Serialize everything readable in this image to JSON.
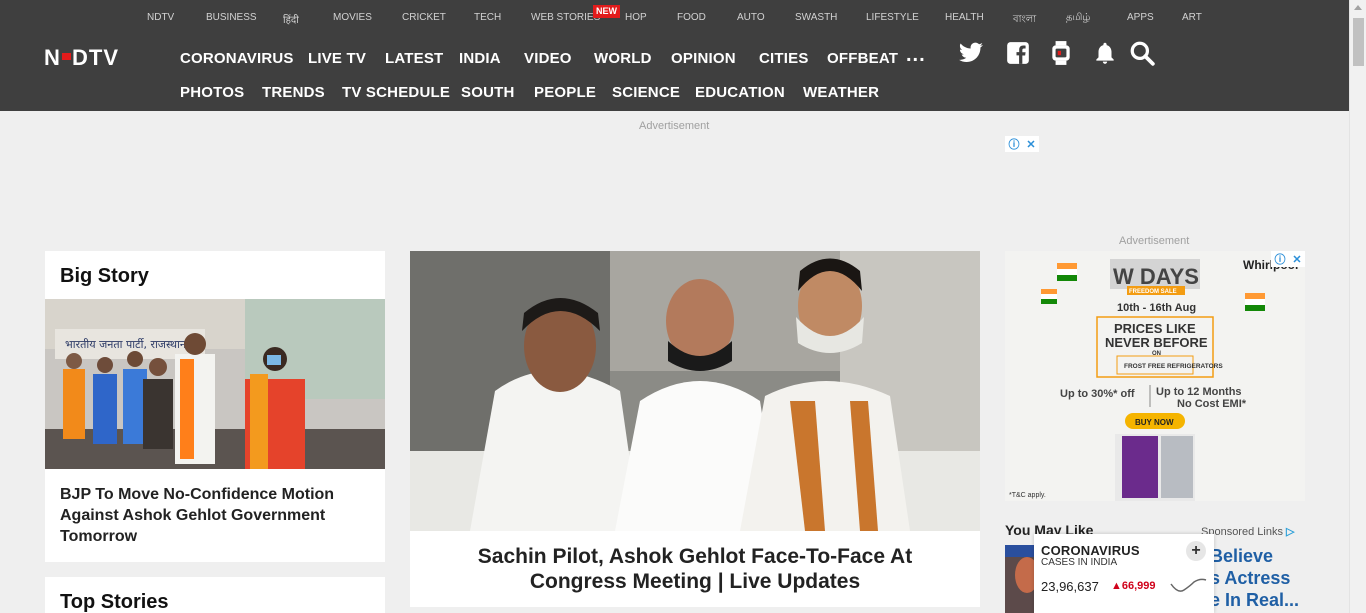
{
  "topnav": [
    "NDTV",
    "BUSINESS",
    "हिंदी",
    "MOVIES",
    "CRICKET",
    "TECH",
    "WEB STORIES",
    "HOP",
    "FOOD",
    "AUTO",
    "SWASTH",
    "LIFESTYLE",
    "HEALTH",
    "বাংলা",
    "தமிழ்",
    "APPS",
    "ART"
  ],
  "new_badge": "NEW",
  "logo_text": "NDTV",
  "mainnav_row1": [
    "CORONAVIRUS",
    "LIVE TV",
    "LATEST",
    "INDIA",
    "VIDEO",
    "WORLD",
    "OPINION",
    "CITIES",
    "OFFBEAT"
  ],
  "mainnav_row2": [
    "PHOTOS",
    "TRENDS",
    "TV SCHEDULE",
    "SOUTH",
    "PEOPLE",
    "SCIENCE",
    "EDUCATION",
    "WEATHER"
  ],
  "more": "...",
  "header_icons": [
    "twitter-icon",
    "facebook-icon",
    "smartwatch-icon",
    "notification-bell-icon",
    "search-icon"
  ],
  "advertisement_label": "Advertisement",
  "big_story": {
    "title": "Big Story",
    "headline": "BJP To Move No-Confidence Motion Against Ashok Gehlot Government Tomorrow",
    "image_text": "भारतीय जनता पार्टी, राजस्थान"
  },
  "top_stories": {
    "title": "Top Stories"
  },
  "hero": {
    "headline": "Sachin Pilot, Ashok Gehlot Face-To-Face At Congress Meeting | Live Updates"
  },
  "right_ad": {
    "label": "Advertisement",
    "brand": "Whirlpool",
    "campaign": "W DAYS",
    "sale": "FREEDOM SALE",
    "dates": "10th - 16th Aug",
    "promo_line1": "PRICES LIKE",
    "promo_line2": "NEVER BEFORE",
    "promo_on": "ON",
    "promo_product": "FROST FREE REFRIGERATORS",
    "offer1": "Up to 30%* off",
    "offer2": "Up to 12 Months No Cost EMI*",
    "cta": "BUY NOW",
    "tnc": "*T&C apply."
  },
  "you_may_like": "You May Like",
  "sponsored": "Sponsored Links",
  "recommendation": {
    "title_lines": [
      "Believe",
      "s Actress",
      "e In Real..."
    ]
  },
  "covid_widget": {
    "title": "CORONAVIRUS",
    "subtitle": "CASES IN INDIA",
    "count": "23,96,637",
    "delta": "66,999",
    "expand": "+"
  }
}
